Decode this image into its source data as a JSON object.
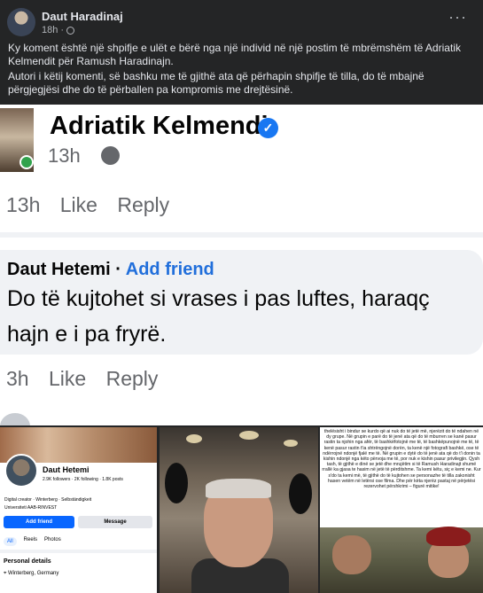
{
  "post": {
    "author": "Daut Haradinaj",
    "time": "18h",
    "dot": "·",
    "more": "···",
    "text_p1": "Ky koment është një shpifje e ulët e bërë nga një individ në një postim të mbrëmshëm të Adriatik Kelmendit për Ramush Haradinajn.",
    "text_p2": "Autori i këtij komenti, së bashku me të gjithë ata që përhapin shpifje të tilla, do të mbajnë përgjegjësi dhe do të përballen pa kompromis me drejtësinë."
  },
  "screenshot": {
    "page_name": "Adriatik Kelmendi",
    "page_time": "13h",
    "dot": "·",
    "actions": {
      "time": "13h",
      "like": "Like",
      "reply": "Reply"
    },
    "comment": {
      "author": "Daut Hetemi",
      "sep": "·",
      "add_friend": "Add friend",
      "line1": "Do të kujtohet si vrases i pas luftes, haraqç",
      "line2": "hajn e i pa fryrë."
    },
    "actions2": {
      "time": "3h",
      "like": "Like",
      "reply": "Reply"
    }
  },
  "profile": {
    "name": "Daut Hetemi",
    "stats": "2.9K followers · 2K following · 1.8K posts",
    "info": [
      "Digital creator · Winterberg · Selbständigkeit",
      "Universiteti AAB-RINVEST"
    ],
    "add_friend": "Add friend",
    "message": "Message",
    "tabs": [
      "All",
      "Reels",
      "Photos"
    ],
    "details_title": "Personal details",
    "location": "Winterberg, Germany"
  },
  "article_text": "thelësisht i bindur se kurdo që ai nuk do të jetë më, njerëzit do të ndahen në dy grupe. Në grupin e parë do të jenë ata që do të mburren se kanë pasur rastin ta njohin nga afër, të bashkëfotojnë me të, të bashkëpunojnë me të, të kenë pasur rastin t'ia shtrëngojnë dorën, ta kenë një fotografi bashkë, ose të ndërrojnë ndonjë fjalë me të. Në grupin e dytë do të jenë ata që do t'i donin ta kishin ndonjë nga këto përvoja me të, por nuk e kishin pasur privilegjin. Qysh tash, të gjithë e dinë se jetë dhe mrujëtim si të Ramush Haradinajt shumë rrallë ka gjasa te hasim në jetë të përditshme. Ta kemi këtu, siç e kemi ne. Kur s'do ta kemi më, të gjithë do të kujtohen se personazhe të tilla zakonisht hasen vetëm në letërsi ose filma. Dhe për këta njerëz pastaj në përjetësi rezervohet përshkrimi – figurë mitike!"
}
